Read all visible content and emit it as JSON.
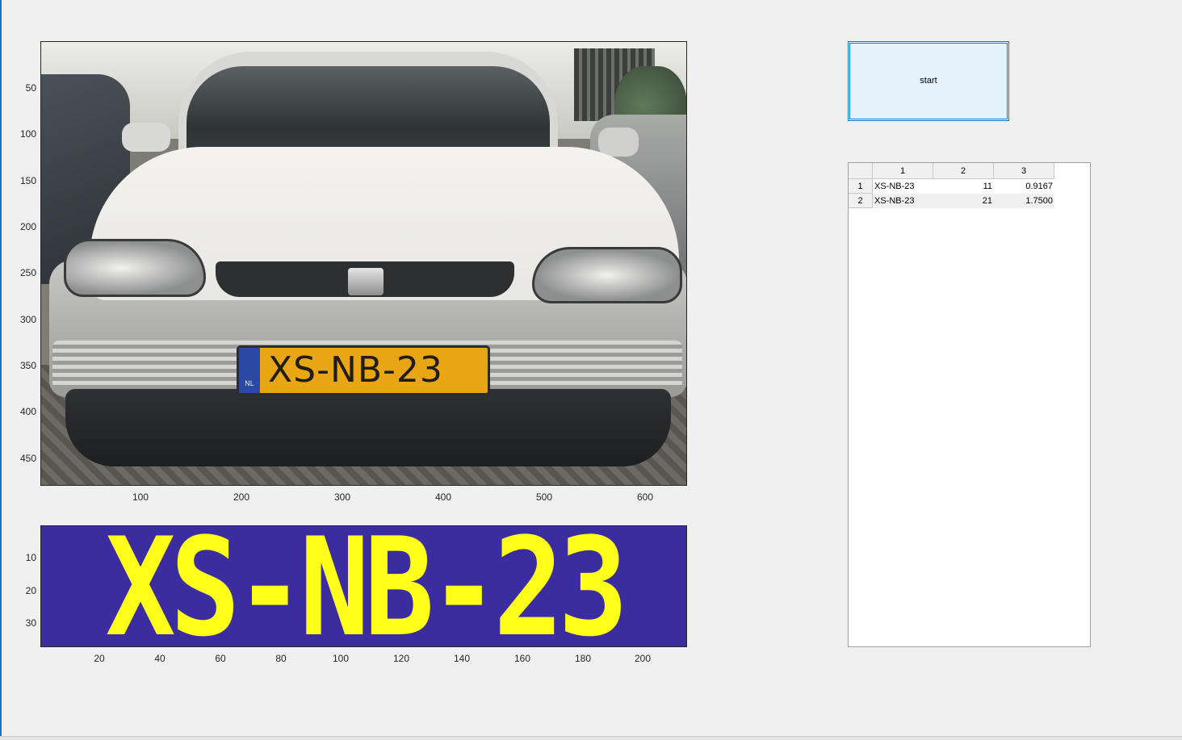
{
  "figure": {
    "start_button_label": "start"
  },
  "image_axes": {
    "ytick_labels": [
      "50",
      "100",
      "150",
      "200",
      "250",
      "300",
      "350",
      "400",
      "450"
    ],
    "xtick_labels": [
      "100",
      "200",
      "300",
      "400",
      "500",
      "600"
    ],
    "plate": {
      "country_code": "NL",
      "text": "XS-NB-23"
    }
  },
  "binary_axes": {
    "text": "XS-NB-23",
    "ytick_labels": [
      "10",
      "20",
      "30"
    ],
    "xtick_labels": [
      "20",
      "40",
      "60",
      "80",
      "100",
      "120",
      "140",
      "160",
      "180",
      "200"
    ],
    "colors": {
      "background": "#3b2d9f",
      "foreground": "#ffff1a"
    }
  },
  "results_table": {
    "column_headers": [
      "1",
      "2",
      "3"
    ],
    "rows": [
      {
        "row_header": "1",
        "cells": [
          "XS-NB-23",
          "11",
          "0.9167"
        ]
      },
      {
        "row_header": "2",
        "cells": [
          "XS-NB-23",
          "21",
          "1.7500"
        ]
      }
    ]
  },
  "colors": {
    "figure_bg": "#f0f0f0",
    "button_bg": "#e5f1fb",
    "button_border": "#0078d7"
  }
}
